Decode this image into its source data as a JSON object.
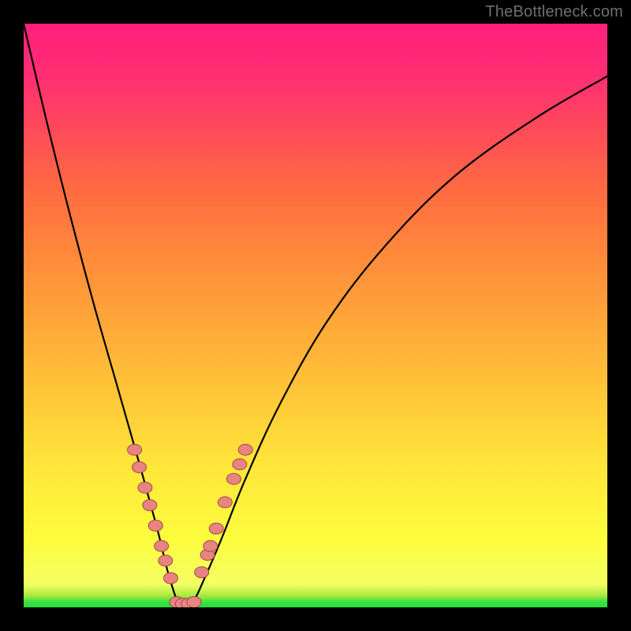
{
  "watermark": "TheBottleneck.com",
  "colors": {
    "frame": "#000000",
    "curve_stroke": "#000000",
    "marker_fill": "#e98381",
    "marker_stroke": "#9e4b48"
  },
  "chart_data": {
    "type": "line",
    "title": "",
    "xlabel": "",
    "ylabel": "",
    "xlim": [
      0,
      100
    ],
    "ylim": [
      0,
      100
    ],
    "grid": false,
    "legend": false,
    "notes": "Bottleneck-style V-curve. X is an unlabeled component-balance axis; Y is bottleneck percentage (0 green at bottom, 100 red at top). Minimum sits around x≈27 at y≈0.",
    "series": [
      {
        "name": "bottleneck_curve",
        "x": [
          0,
          4,
          8,
          12,
          16,
          20,
          23,
          25,
          27,
          29,
          31,
          34,
          38,
          44,
          52,
          62,
          74,
          88,
          100
        ],
        "y": [
          100,
          83,
          67,
          52,
          38,
          24,
          13,
          5,
          0,
          1,
          5,
          12,
          22,
          35,
          49,
          62,
          74,
          84,
          91
        ]
      }
    ],
    "markers": {
      "comment": "Salmon dot clusters along both arms of the V near the minimum",
      "left_arm": [
        {
          "x": 19.0,
          "y": 27.0
        },
        {
          "x": 19.8,
          "y": 24.0
        },
        {
          "x": 20.8,
          "y": 20.5
        },
        {
          "x": 21.6,
          "y": 17.5
        },
        {
          "x": 22.6,
          "y": 14.0
        },
        {
          "x": 23.6,
          "y": 10.5
        },
        {
          "x": 24.3,
          "y": 8.0
        },
        {
          "x": 25.2,
          "y": 5.0
        }
      ],
      "right_arm": [
        {
          "x": 30.5,
          "y": 6.0
        },
        {
          "x": 31.5,
          "y": 9.0
        },
        {
          "x": 32.0,
          "y": 10.5
        },
        {
          "x": 33.0,
          "y": 13.5
        },
        {
          "x": 34.5,
          "y": 18.0
        },
        {
          "x": 36.0,
          "y": 22.0
        },
        {
          "x": 37.0,
          "y": 24.5
        },
        {
          "x": 38.0,
          "y": 27.0
        }
      ],
      "bottom": [
        {
          "x": 26.2,
          "y": 0.9
        },
        {
          "x": 27.2,
          "y": 0.6
        },
        {
          "x": 28.2,
          "y": 0.6
        },
        {
          "x": 29.2,
          "y": 0.9
        }
      ]
    }
  }
}
